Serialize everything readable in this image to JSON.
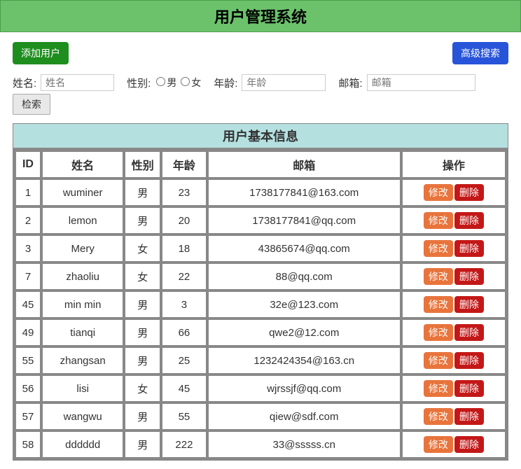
{
  "header": {
    "title": "用户管理系统"
  },
  "toolbar": {
    "add_label": "添加用户",
    "adv_search_label": "高级搜索"
  },
  "search": {
    "name_label": "姓名:",
    "name_placeholder": "姓名",
    "gender_label": "性别:",
    "gender_male": "男",
    "gender_female": "女",
    "age_label": "年龄:",
    "age_placeholder": "年龄",
    "email_label": "邮箱:",
    "email_placeholder": "邮箱",
    "submit_label": "检索"
  },
  "table": {
    "caption": "用户基本信息",
    "headers": {
      "id": "ID",
      "name": "姓名",
      "gender": "性别",
      "age": "年龄",
      "email": "邮箱",
      "ops": "操作"
    },
    "op_edit": "修改",
    "op_delete": "删除",
    "rows": [
      {
        "id": "1",
        "name": "wuminer",
        "gender": "男",
        "age": "23",
        "email": "1738177841@163.com"
      },
      {
        "id": "2",
        "name": "lemon",
        "gender": "男",
        "age": "20",
        "email": "1738177841@qq.com"
      },
      {
        "id": "3",
        "name": "Mery",
        "gender": "女",
        "age": "18",
        "email": "43865674@qq.com"
      },
      {
        "id": "7",
        "name": "zhaoliu",
        "gender": "女",
        "age": "22",
        "email": "88@qq.com"
      },
      {
        "id": "45",
        "name": "min min",
        "gender": "男",
        "age": "3",
        "email": "32e@123.com"
      },
      {
        "id": "49",
        "name": "tianqi",
        "gender": "男",
        "age": "66",
        "email": "qwe2@12.com"
      },
      {
        "id": "55",
        "name": "zhangsan",
        "gender": "男",
        "age": "25",
        "email": "1232424354@163.cn"
      },
      {
        "id": "56",
        "name": "lisi",
        "gender": "女",
        "age": "45",
        "email": "wjrssjf@qq.com"
      },
      {
        "id": "57",
        "name": "wangwu",
        "gender": "男",
        "age": "55",
        "email": "qiew@sdf.com"
      },
      {
        "id": "58",
        "name": "dddddd",
        "gender": "男",
        "age": "222",
        "email": "33@sssss.cn"
      }
    ]
  }
}
